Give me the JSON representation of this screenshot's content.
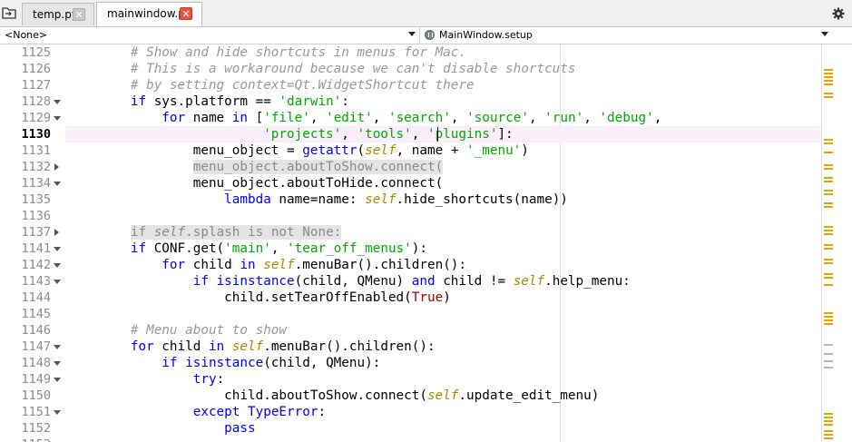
{
  "tabs": [
    {
      "label": "temp.py",
      "active": false
    },
    {
      "label": "mainwindow.py",
      "active": true
    }
  ],
  "combo": {
    "class_selector": "<None>",
    "method_selector": "MainWindow.setup"
  },
  "editor": {
    "current_line": "1130",
    "lines": [
      {
        "n": "1125",
        "fold": "",
        "tokens": [
          [
            "        ",
            ""
          ],
          [
            "# Show and hide shortcuts in menus for Mac.",
            "com"
          ]
        ]
      },
      {
        "n": "1126",
        "fold": "",
        "tokens": [
          [
            "        ",
            ""
          ],
          [
            "# This is a workaround because we can't disable shortcuts",
            "com"
          ]
        ]
      },
      {
        "n": "1127",
        "fold": "",
        "tokens": [
          [
            "        ",
            ""
          ],
          [
            "# by setting context=Qt.WidgetShortcut there",
            "com"
          ]
        ]
      },
      {
        "n": "1128",
        "fold": "down",
        "tokens": [
          [
            "        ",
            ""
          ],
          [
            "if",
            "kw"
          ],
          [
            " sys.platform == ",
            ""
          ],
          [
            "'darwin'",
            "str"
          ],
          [
            ":",
            ""
          ]
        ]
      },
      {
        "n": "1129",
        "fold": "down",
        "tokens": [
          [
            "            ",
            ""
          ],
          [
            "for",
            "kw"
          ],
          [
            " name ",
            ""
          ],
          [
            "in",
            "kw"
          ],
          [
            " [",
            ""
          ],
          [
            "'file'",
            "str"
          ],
          [
            ", ",
            ""
          ],
          [
            "'edit'",
            "str"
          ],
          [
            ", ",
            ""
          ],
          [
            "'search'",
            "str"
          ],
          [
            ", ",
            ""
          ],
          [
            "'source'",
            "str"
          ],
          [
            ", ",
            ""
          ],
          [
            "'run'",
            "str"
          ],
          [
            ", ",
            ""
          ],
          [
            "'debug'",
            "str"
          ],
          [
            ",",
            ""
          ]
        ]
      },
      {
        "n": "1130",
        "fold": "",
        "tokens": [
          [
            "                         ",
            ""
          ],
          [
            "'projects'",
            "str"
          ],
          [
            ", ",
            ""
          ],
          [
            "'tools'",
            "str"
          ],
          [
            ", ",
            ""
          ],
          [
            "'plugins'",
            "str"
          ],
          [
            "]:",
            ""
          ]
        ]
      },
      {
        "n": "1131",
        "fold": "",
        "tokens": [
          [
            "                ",
            ""
          ],
          [
            "menu_object = ",
            ""
          ],
          [
            "getattr",
            "kw"
          ],
          [
            "(",
            ""
          ],
          [
            "self",
            "self"
          ],
          [
            ", name + ",
            ""
          ],
          [
            "'_menu'",
            "str"
          ],
          [
            ")",
            ""
          ]
        ]
      },
      {
        "n": "1132",
        "fold": "right",
        "tokens": [
          [
            "                ",
            ""
          ],
          [
            "menu_object.aboutToShow.connect(",
            "fold"
          ]
        ]
      },
      {
        "n": "1134",
        "fold": "down",
        "tokens": [
          [
            "                ",
            ""
          ],
          [
            "menu_object.aboutToHide.connect(",
            ""
          ]
        ]
      },
      {
        "n": "1135",
        "fold": "",
        "tokens": [
          [
            "                    ",
            ""
          ],
          [
            "lambda",
            "kw"
          ],
          [
            " name=name: ",
            ""
          ],
          [
            "self",
            "self"
          ],
          [
            ".hide_shortcuts(name))",
            ""
          ]
        ]
      },
      {
        "n": "1136",
        "fold": "",
        "tokens": []
      },
      {
        "n": "1137",
        "fold": "right",
        "tokens": [
          [
            "        ",
            ""
          ],
          [
            "if ",
            "fold"
          ],
          [
            "self",
            "foldself"
          ],
          [
            ".splash is not None:",
            "fold"
          ]
        ]
      },
      {
        "n": "1141",
        "fold": "down",
        "tokens": [
          [
            "        ",
            ""
          ],
          [
            "if",
            "kw"
          ],
          [
            " CONF.get(",
            ""
          ],
          [
            "'main'",
            "str"
          ],
          [
            ", ",
            ""
          ],
          [
            "'tear_off_menus'",
            "str"
          ],
          [
            "):",
            ""
          ]
        ]
      },
      {
        "n": "1142",
        "fold": "down",
        "tokens": [
          [
            "            ",
            ""
          ],
          [
            "for",
            "kw"
          ],
          [
            " child ",
            ""
          ],
          [
            "in",
            "kw"
          ],
          [
            " ",
            ""
          ],
          [
            "self",
            "self"
          ],
          [
            ".menuBar().children():",
            ""
          ]
        ]
      },
      {
        "n": "1143",
        "fold": "down",
        "tokens": [
          [
            "                ",
            ""
          ],
          [
            "if",
            "kw"
          ],
          [
            " ",
            ""
          ],
          [
            "isinstance",
            "kw"
          ],
          [
            "(child, QMenu) ",
            ""
          ],
          [
            "and",
            "kw"
          ],
          [
            " child != ",
            ""
          ],
          [
            "self",
            "self"
          ],
          [
            ".help_menu:",
            ""
          ]
        ]
      },
      {
        "n": "1144",
        "fold": "",
        "tokens": [
          [
            "                    ",
            ""
          ],
          [
            "child.setTearOffEnabled(",
            ""
          ],
          [
            "True",
            "num"
          ],
          [
            ")",
            ""
          ]
        ]
      },
      {
        "n": "1145",
        "fold": "",
        "tokens": []
      },
      {
        "n": "1146",
        "fold": "",
        "tokens": [
          [
            "        ",
            ""
          ],
          [
            "# Menu about to show",
            "com"
          ]
        ]
      },
      {
        "n": "1147",
        "fold": "down",
        "tokens": [
          [
            "        ",
            ""
          ],
          [
            "for",
            "kw"
          ],
          [
            " child ",
            ""
          ],
          [
            "in",
            "kw"
          ],
          [
            " ",
            ""
          ],
          [
            "self",
            "self"
          ],
          [
            ".menuBar().children():",
            ""
          ]
        ]
      },
      {
        "n": "1148",
        "fold": "down",
        "tokens": [
          [
            "            ",
            ""
          ],
          [
            "if",
            "kw"
          ],
          [
            " ",
            ""
          ],
          [
            "isinstance",
            "kw"
          ],
          [
            "(child, QMenu):",
            ""
          ]
        ]
      },
      {
        "n": "1149",
        "fold": "down",
        "tokens": [
          [
            "                ",
            ""
          ],
          [
            "try",
            "kw"
          ],
          [
            ":",
            ""
          ]
        ]
      },
      {
        "n": "1150",
        "fold": "",
        "tokens": [
          [
            "                    ",
            ""
          ],
          [
            "child.aboutToShow.connect(",
            ""
          ],
          [
            "self",
            "self"
          ],
          [
            ".update_edit_menu)",
            ""
          ]
        ]
      },
      {
        "n": "1151",
        "fold": "down",
        "tokens": [
          [
            "                ",
            ""
          ],
          [
            "except",
            "kw"
          ],
          [
            " ",
            ""
          ],
          [
            "TypeError",
            "kw"
          ],
          [
            ":",
            ""
          ]
        ]
      },
      {
        "n": "1152",
        "fold": "",
        "tokens": [
          [
            "                    ",
            ""
          ],
          [
            "pass",
            "kw"
          ]
        ]
      },
      {
        "n": "1153",
        "fold": "",
        "tokens": []
      }
    ]
  },
  "icons": {
    "browse": "open-folder-icon",
    "options": "gear-icon",
    "method": "method-icon"
  },
  "colors": {
    "keyword": "#0000ff",
    "string": "#00aa00",
    "comment": "#999999",
    "self": "#aa8800",
    "current_line_bg": "#fbeefb",
    "flag_marker": "#e8a500",
    "tab_close_active": "#e9543c"
  }
}
